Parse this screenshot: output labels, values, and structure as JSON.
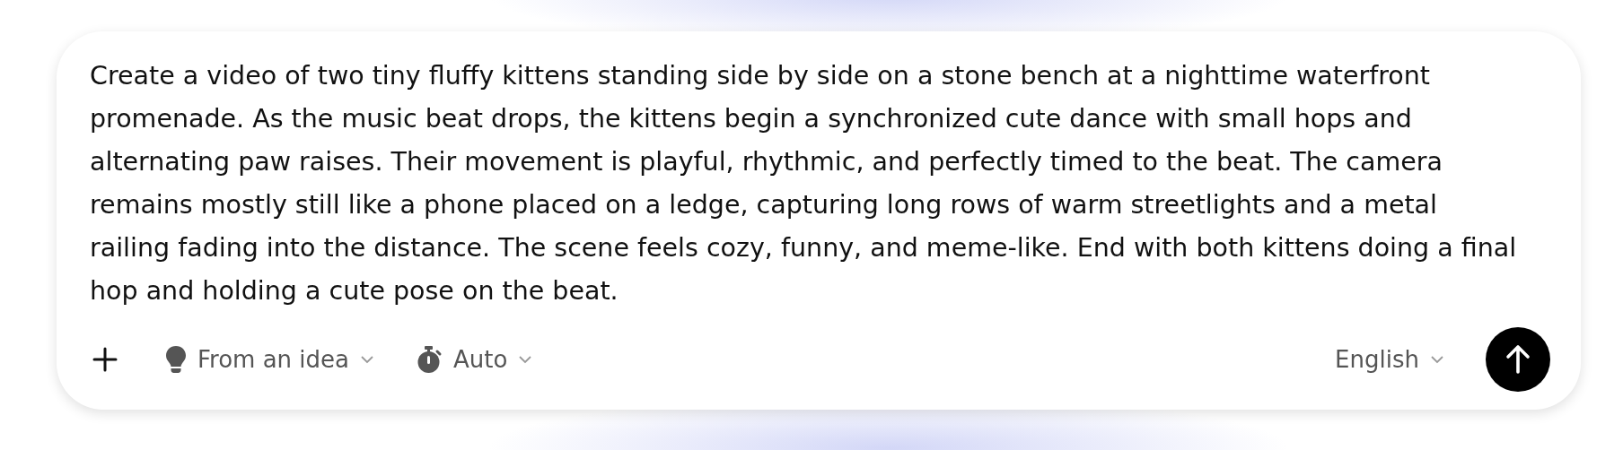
{
  "prompt": {
    "value": "Create a video of two tiny fluffy kittens standing side by side on a stone bench at a nighttime waterfront promenade. As the music beat drops, the kittens begin a synchronized cute dance with small hops and alternating paw raises. Their movement is playful, rhythmic, and perfectly timed to the beat. The camera remains mostly still like a phone placed on a ledge, capturing long rows of warm streetlights and a metal railing fading into the distance. The scene feels cozy, funny, and meme-like. End with both kittens doing a final hop and holding a cute pose on the beat."
  },
  "toolbar": [
    {
      "kind": "mode",
      "label": "From an idea"
    },
    {
      "kind": "duration",
      "label": "Auto"
    }
  ],
  "language": {
    "label": "English"
  }
}
